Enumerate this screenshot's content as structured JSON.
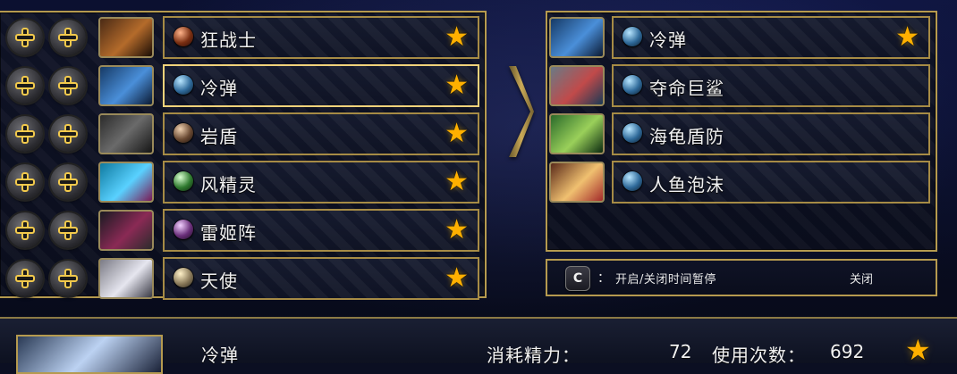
{
  "left_list": {
    "rows": [
      {
        "label": "狂战士",
        "orb": "orb-brown",
        "thumb": "thumb-a"
      },
      {
        "label": "冷弹",
        "orb": "orb-blue",
        "thumb": "thumb-b"
      },
      {
        "label": "岩盾",
        "orb": "orb-earth",
        "thumb": "thumb-c"
      },
      {
        "label": "风精灵",
        "orb": "orb-green",
        "thumb": "thumb-d"
      },
      {
        "label": "雷姬阵",
        "orb": "orb-purple",
        "thumb": "thumb-e"
      },
      {
        "label": "天使",
        "orb": "orb-tan",
        "thumb": "thumb-f"
      }
    ]
  },
  "right_list": {
    "rows": [
      {
        "label": "冷弹",
        "orb": "orb-blue",
        "thumb": "thumb-b",
        "star": true
      },
      {
        "label": "夺命巨鲨",
        "orb": "orb-blue",
        "thumb": "thumb-g",
        "star": false
      },
      {
        "label": "海龟盾防",
        "orb": "orb-blue",
        "thumb": "thumb-h",
        "star": false
      },
      {
        "label": "人鱼泡沫",
        "orb": "orb-blue",
        "thumb": "thumb-i",
        "star": false
      }
    ]
  },
  "hint": {
    "key": "C",
    "colon": "：",
    "text": "开启/关闭时间暂停",
    "state": "关闭"
  },
  "bottom": {
    "name": "冷弹",
    "cost_label": "消耗精力：",
    "cost_value": "72",
    "uses_label": "使用次数：",
    "uses_value": "692"
  },
  "icons": {
    "star": "star-icon",
    "dpad": "dpad-icon",
    "arrow": "chevron-right-icon"
  },
  "colors": {
    "gold_border": "#b59a4f",
    "star": "#ffb000"
  }
}
